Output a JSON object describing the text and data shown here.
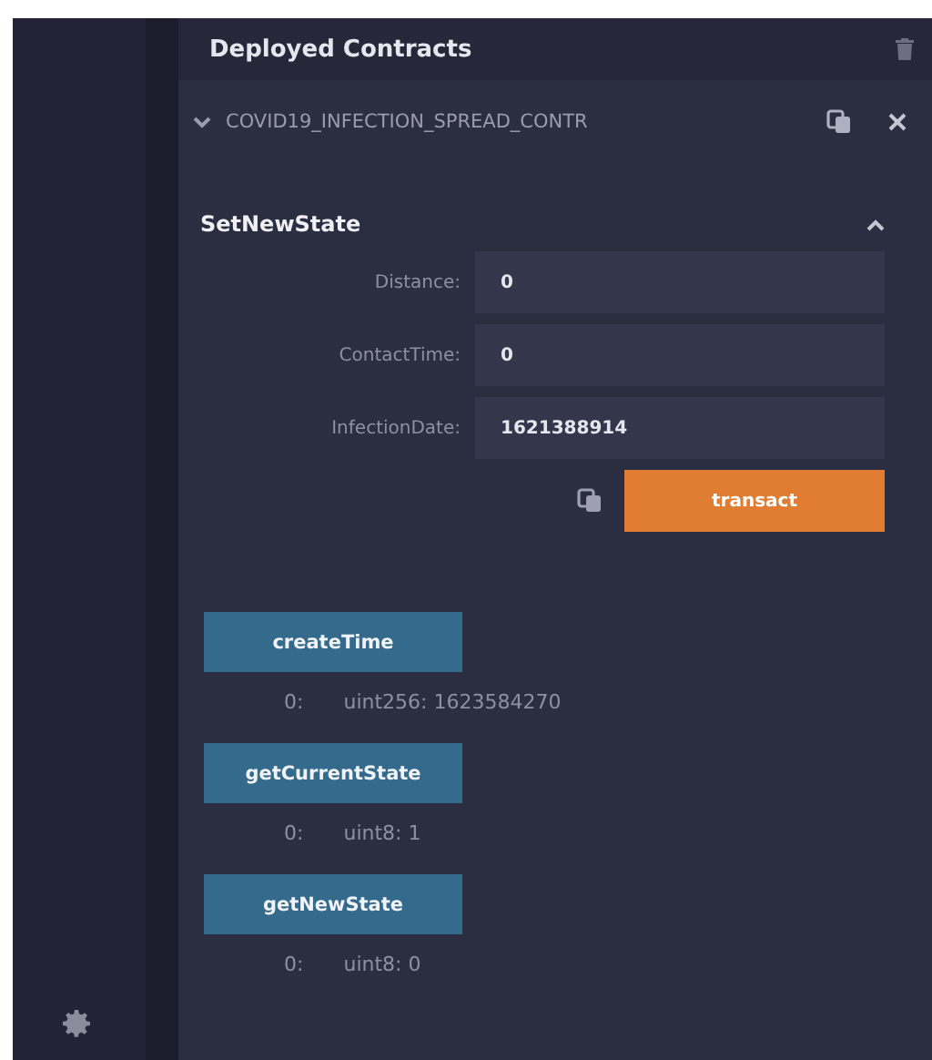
{
  "panel": {
    "title": "Deployed Contracts"
  },
  "contract": {
    "name": "COVID19_INFECTION_SPREAD_CONTR",
    "expanded": true
  },
  "function": {
    "name": "SetNewState",
    "expanded": true,
    "inputs": [
      {
        "label": "Distance:",
        "value": "0"
      },
      {
        "label": "ContactTime:",
        "value": "0"
      },
      {
        "label": "InfectionDate:",
        "value": "1621388914"
      }
    ],
    "action": "transact"
  },
  "calls": [
    {
      "name": "createTime",
      "index": "0:",
      "result": "uint256: 1623584270"
    },
    {
      "name": "getCurrentState",
      "index": "0:",
      "result": "uint8: 1"
    },
    {
      "name": "getNewState",
      "index": "0:",
      "result": "uint8: 0"
    }
  ]
}
